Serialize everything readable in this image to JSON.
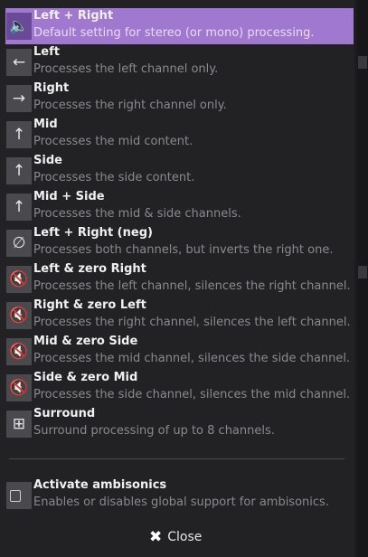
{
  "items": [
    {
      "icon": "speaker-icon",
      "glyph": "🔈",
      "title": "Left + Right",
      "description": "Default setting for stereo (or mono) processing.",
      "selected": true
    },
    {
      "icon": "arrow-left-icon",
      "glyph": "←",
      "title": "Left",
      "description": "Processes the left channel only.",
      "selected": false
    },
    {
      "icon": "arrow-right-icon",
      "glyph": "→",
      "title": "Right",
      "description": "Processes the right channel only.",
      "selected": false
    },
    {
      "icon": "arrow-up-icon",
      "glyph": "↑",
      "title": "Mid",
      "description": "Processes the mid content.",
      "selected": false
    },
    {
      "icon": "arrow-up-icon",
      "glyph": "↑",
      "title": "Side",
      "description": "Processes the side content.",
      "selected": false
    },
    {
      "icon": "arrow-up-icon",
      "glyph": "↑",
      "title": "Mid + Side",
      "description": "Processes the mid & side channels.",
      "selected": false
    },
    {
      "icon": "invert-phase-icon",
      "glyph": "∅",
      "title": "Left + Right (neg)",
      "description": "Processes both channels, but inverts the right one.",
      "selected": false
    },
    {
      "icon": "speaker-muted-icon",
      "glyph": "🔇",
      "title": "Left & zero Right",
      "description": "Processes the left channel, silences the right channel.",
      "selected": false
    },
    {
      "icon": "speaker-muted-icon",
      "glyph": "🔇",
      "title": "Right & zero Left",
      "description": "Processes the right channel, silences the left channel.",
      "selected": false
    },
    {
      "icon": "speaker-muted-icon",
      "glyph": "🔇",
      "title": "Mid & zero Side",
      "description": "Processes the mid channel, silences the side channel.",
      "selected": false
    },
    {
      "icon": "speaker-muted-icon",
      "glyph": "🔇",
      "title": "Side & zero Mid",
      "description": "Processes the side channel, silences the mid channel.",
      "selected": false
    },
    {
      "icon": "surround-grid-icon",
      "glyph": "⊞",
      "title": "Surround",
      "description": "Surround processing of up to 8 channels.",
      "selected": false
    }
  ],
  "ambisonics": {
    "title": "Activate ambisonics",
    "description": "Enables or disables global support for ambisonics.",
    "checked": false
  },
  "close": {
    "label": "Close",
    "glyph": "✖"
  },
  "colors": {
    "accent": "#a078d0",
    "background": "#222224"
  }
}
